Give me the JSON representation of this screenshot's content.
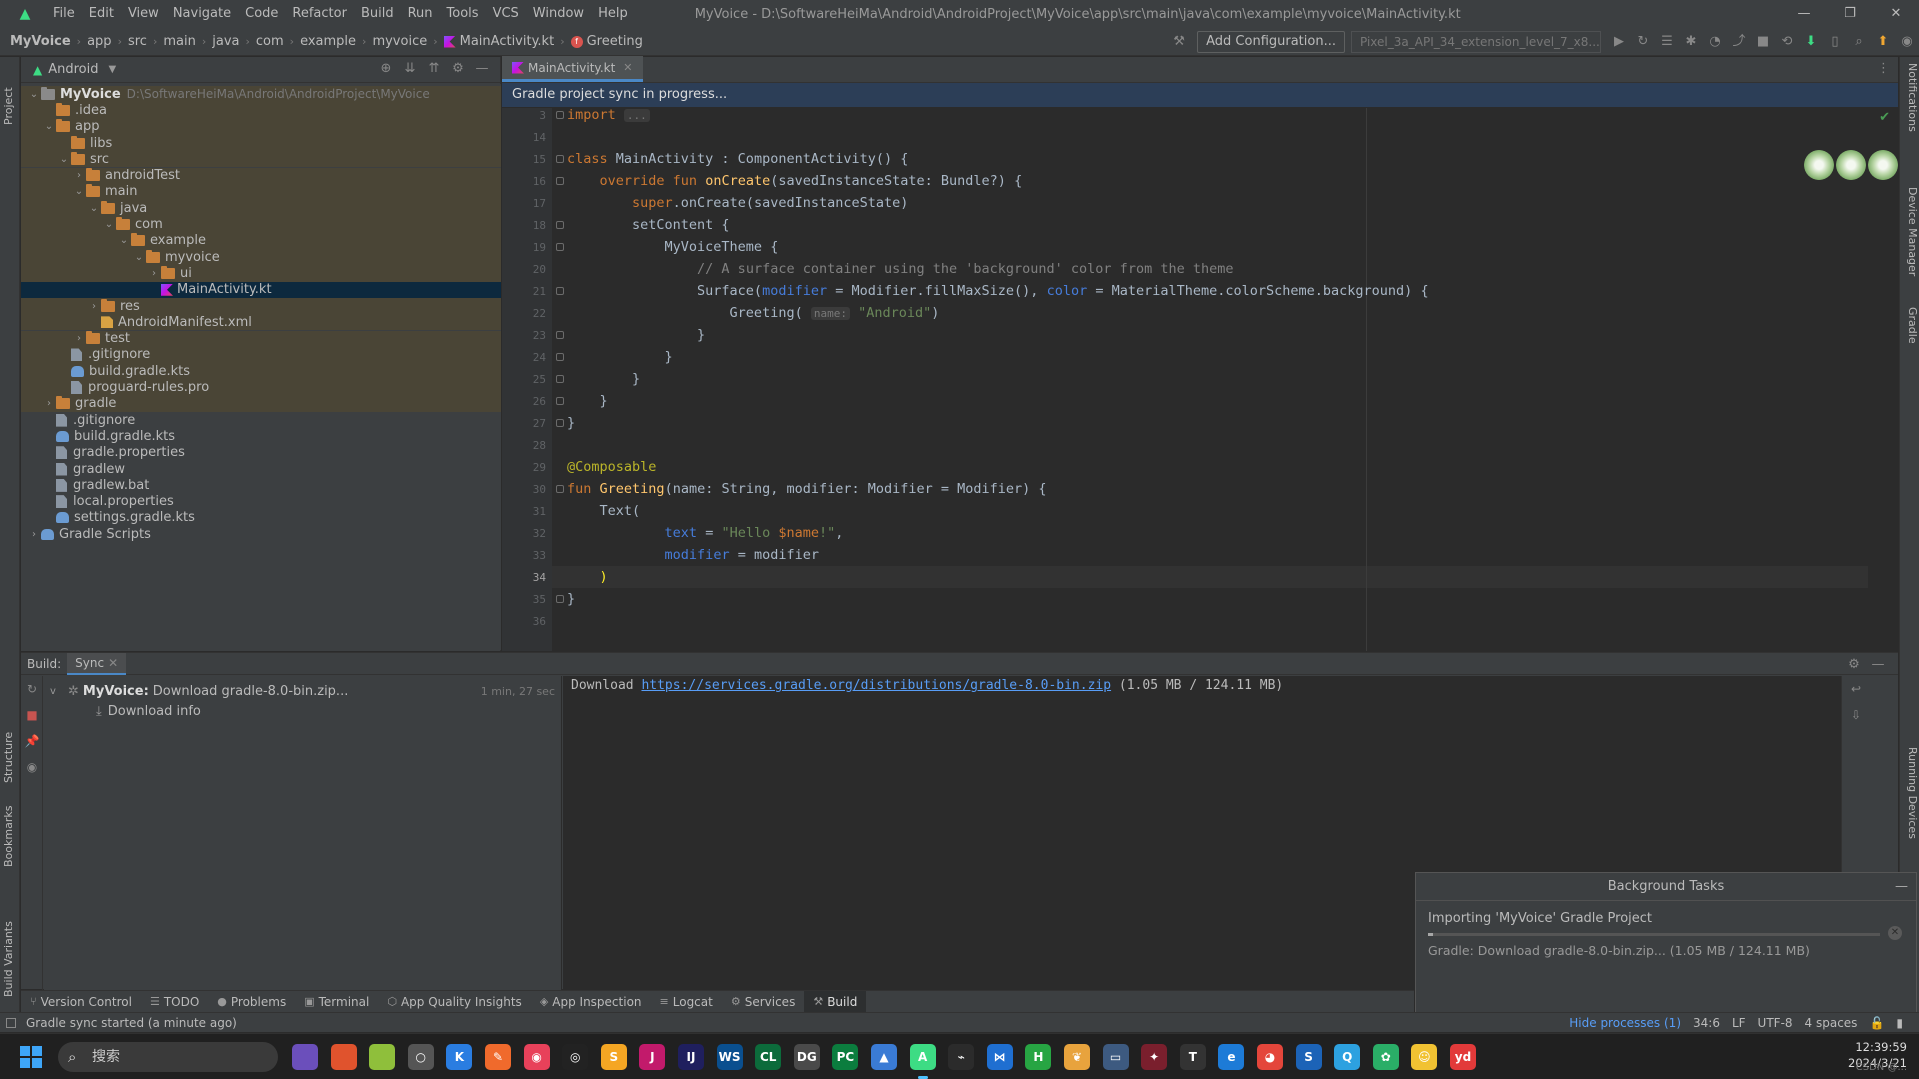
{
  "menubar": {
    "items": [
      "File",
      "Edit",
      "View",
      "Navigate",
      "Code",
      "Refactor",
      "Build",
      "Run",
      "Tools",
      "VCS",
      "Window",
      "Help"
    ],
    "title": "MyVoice - D:\\SoftwareHeiMa\\Android\\AndroidProject\\MyVoice\\app\\src\\main\\java\\com\\example\\myvoice\\MainActivity.kt"
  },
  "navbar": {
    "crumbs": [
      "MyVoice",
      "app",
      "src",
      "main",
      "java",
      "com",
      "example",
      "myvoice",
      "MainActivity.kt",
      "Greeting"
    ],
    "add_config": "Add Configuration...",
    "device": "Pixel_3a_API_34_extension_level_7_x8..."
  },
  "project": {
    "view": "Android",
    "tree": [
      {
        "label": "MyVoice",
        "extra": "D:\\SoftwareHeiMa\\Android\\AndroidProject\\MyVoice",
        "depth": 0,
        "arrow": "v",
        "icon": "folder-plain",
        "bold": true,
        "tinted": true
      },
      {
        "label": ".idea",
        "depth": 1,
        "arrow": "",
        "icon": "folder",
        "tinted": true
      },
      {
        "label": "app",
        "depth": 1,
        "arrow": "v",
        "icon": "folder",
        "tinted": true
      },
      {
        "label": "libs",
        "depth": 2,
        "arrow": "",
        "icon": "folder",
        "tinted": true
      },
      {
        "label": "src",
        "depth": 2,
        "arrow": "v",
        "icon": "folder",
        "tinted": true
      },
      {
        "label": "androidTest",
        "depth": 3,
        "arrow": ">",
        "icon": "folder",
        "tinted": true
      },
      {
        "label": "main",
        "depth": 3,
        "arrow": "v",
        "icon": "folder",
        "tinted": true
      },
      {
        "label": "java",
        "depth": 4,
        "arrow": "v",
        "icon": "folder",
        "tinted": true
      },
      {
        "label": "com",
        "depth": 5,
        "arrow": "v",
        "icon": "folder",
        "tinted": true
      },
      {
        "label": "example",
        "depth": 6,
        "arrow": "v",
        "icon": "folder",
        "tinted": true
      },
      {
        "label": "myvoice",
        "depth": 7,
        "arrow": "v",
        "icon": "folder",
        "tinted": true
      },
      {
        "label": "ui",
        "depth": 8,
        "arrow": ">",
        "icon": "folder",
        "tinted": true
      },
      {
        "label": "MainActivity.kt",
        "depth": 8,
        "arrow": "",
        "icon": "kotlin",
        "selected": true
      },
      {
        "label": "res",
        "depth": 4,
        "arrow": ">",
        "icon": "folder",
        "tinted": true
      },
      {
        "label": "AndroidManifest.xml",
        "depth": 4,
        "arrow": "",
        "icon": "xml",
        "tinted": true
      },
      {
        "label": "test",
        "depth": 3,
        "arrow": ">",
        "icon": "folder",
        "tinted": true
      },
      {
        "label": ".gitignore",
        "depth": 2,
        "arrow": "",
        "icon": "file",
        "tinted": true
      },
      {
        "label": "build.gradle.kts",
        "depth": 2,
        "arrow": "",
        "icon": "gradle",
        "tinted": true
      },
      {
        "label": "proguard-rules.pro",
        "depth": 2,
        "arrow": "",
        "icon": "file",
        "tinted": true
      },
      {
        "label": "gradle",
        "depth": 1,
        "arrow": ">",
        "icon": "folder",
        "tinted": true
      },
      {
        "label": ".gitignore",
        "depth": 1,
        "arrow": "",
        "icon": "file"
      },
      {
        "label": "build.gradle.kts",
        "depth": 1,
        "arrow": "",
        "icon": "gradle"
      },
      {
        "label": "gradle.properties",
        "depth": 1,
        "arrow": "",
        "icon": "file"
      },
      {
        "label": "gradlew",
        "depth": 1,
        "arrow": "",
        "icon": "file"
      },
      {
        "label": "gradlew.bat",
        "depth": 1,
        "arrow": "",
        "icon": "file"
      },
      {
        "label": "local.properties",
        "depth": 1,
        "arrow": "",
        "icon": "file"
      },
      {
        "label": "settings.gradle.kts",
        "depth": 1,
        "arrow": "",
        "icon": "gradle"
      },
      {
        "label": "Gradle Scripts",
        "depth": 0,
        "arrow": ">",
        "icon": "gradle"
      }
    ]
  },
  "editor": {
    "tab": "MainActivity.kt",
    "banner": "Gradle project sync in progress...",
    "current_line": 34,
    "lines": [
      {
        "n": "3",
        "html": "<span class=\"kw\">import</span> <span class=\"hint\">...</span>"
      },
      {
        "n": "14",
        "html": ""
      },
      {
        "n": "15",
        "html": "<span class=\"kw\">class</span> MainActivity : ComponentActivity() {"
      },
      {
        "n": "16",
        "html": "    <span class=\"kw\">override fun</span> <span class=\"fn\">onCreate</span>(savedInstanceState: Bundle?) {"
      },
      {
        "n": "17",
        "html": "        <span class=\"kw\">super</span>.onCreate(savedInstanceState)"
      },
      {
        "n": "18",
        "html": "        setContent {"
      },
      {
        "n": "19",
        "html": "            MyVoiceTheme {"
      },
      {
        "n": "20",
        "html": "                <span class=\"cm\">// A surface container using the 'background' color from the theme</span>"
      },
      {
        "n": "21",
        "html": "                Surface(<span class=\"named\">modifier</span> = Modifier.fillMaxSize(), <span class=\"named\">color</span> = MaterialTheme.colorScheme.background) {"
      },
      {
        "n": "22",
        "html": "                    Greeting( <span class=\"hint\">name:</span> <span class=\"str\">\"Android\"</span>)"
      },
      {
        "n": "23",
        "html": "                }"
      },
      {
        "n": "24",
        "html": "            }"
      },
      {
        "n": "25",
        "html": "        }"
      },
      {
        "n": "26",
        "html": "    }"
      },
      {
        "n": "27",
        "html": "}"
      },
      {
        "n": "28",
        "html": ""
      },
      {
        "n": "29",
        "html": "<span class=\"ann\">@Composable</span>"
      },
      {
        "n": "30",
        "html": "<span class=\"kw\">fun</span> <span class=\"fn\">Greeting</span>(name: String, modifier: Modifier = Modifier) {"
      },
      {
        "n": "31",
        "html": "    Text("
      },
      {
        "n": "32",
        "html": "            <span class=\"named\">text</span> = <span class=\"str\">\"Hello </span><span class=\"interp\">$name</span><span class=\"str\">!\"</span>,"
      },
      {
        "n": "33",
        "html": "            <span class=\"named\">modifier</span> = modifier"
      },
      {
        "n": "34",
        "html": "    <span style=\"color:#ffef28\">)</span>"
      },
      {
        "n": "35",
        "html": "}"
      },
      {
        "n": "36",
        "html": ""
      }
    ]
  },
  "build": {
    "label": "Build:",
    "tab": "Sync",
    "task_name": "MyVoice:",
    "task_desc": "Download gradle-8.0-bin.zip...",
    "task_time": "1 min, 27 sec",
    "sub_item": "Download info",
    "console_prefix": "Download ",
    "console_url": "https://services.gradle.org/distributions/gradle-8.0-bin.zip",
    "console_suffix": " (1.05 MB / 124.11 MB)"
  },
  "bgtasks": {
    "title": "Background Tasks",
    "task": "Importing 'MyVoice' Gradle Project",
    "progress": 0.01,
    "detail": "Gradle: Download gradle-8.0-bin.zip... (1.05 MB / 124.11 MB)"
  },
  "tooltabs": [
    "Version Control",
    "TODO",
    "Problems",
    "Terminal",
    "App Quality Insights",
    "App Inspection",
    "Logcat",
    "Services",
    "Build"
  ],
  "status": {
    "message": "Gradle sync started (a minute ago)",
    "hide": "Hide processes (1)",
    "pos": "34:6",
    "lf": "LF",
    "enc": "UTF-8",
    "indent": "4 spaces"
  },
  "leftstrip": {
    "project": "Project",
    "structure": "Structure",
    "bookmarks": "Bookmarks",
    "build_variants": "Build Variants"
  },
  "rightstrip": {
    "notifications": "Notifications",
    "device_manager": "Device Manager",
    "gradle": "Gradle",
    "running_devices": "Running Devices"
  },
  "taskbar": {
    "search": "搜索",
    "time": "12:39:59",
    "date": "2024/3/21",
    "watermark": "CSDN @..."
  },
  "colors": {
    "accent": "#4a88c7",
    "sync_banner": "#2c3e57",
    "tree_tint": "#4a4536",
    "selection": "#0d293e"
  }
}
